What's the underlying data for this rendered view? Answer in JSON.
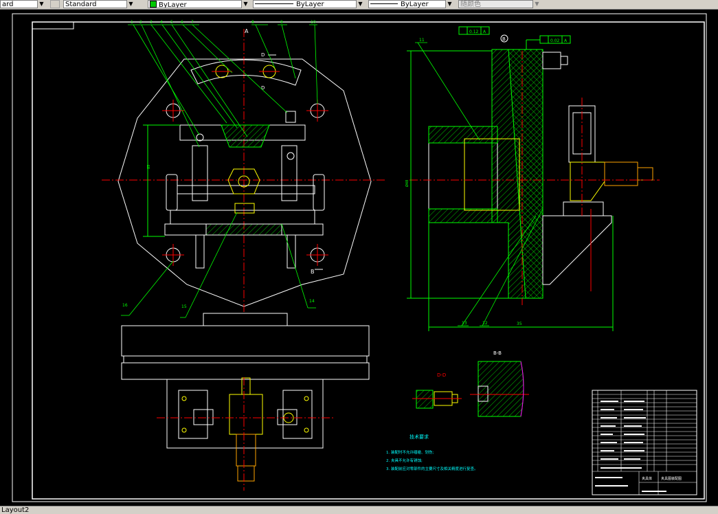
{
  "toolbar": {
    "textstyle_value": "ard",
    "dimstyle_value": "Standard",
    "layer_value": "ByLayer",
    "linetype_value": "ByLayer",
    "lineweight_value": "ByLayer",
    "plotstyle_value": "随颜色"
  },
  "status": {
    "layout_tab": "Layout2"
  },
  "drawing": {
    "section_bb": "B-B",
    "section_dd": "D-D",
    "section_a": "A",
    "label_b": "B",
    "label_d": "D",
    "tolerance_1": "0.12",
    "tolerance_1_datum": "A",
    "tolerance_2": "0.02",
    "tolerance_2_datum": "A",
    "datum_b": "B",
    "tech_title": "技术要求",
    "tech_notes": [
      "1. 装配时不允许磕碰、划伤;",
      "2. 夹具不允许有锈蚀;",
      "3. 装配前应对零部件的主要尺寸及相关精度进行复查。"
    ],
    "callouts": [
      "1",
      "2",
      "3",
      "4",
      "5",
      "6",
      "7",
      "8",
      "9",
      "10",
      "11",
      "12",
      "13",
      "14",
      "15",
      "16"
    ],
    "dim_height": "85",
    "dim_width": "35",
    "dim_left": "Ø48",
    "title_block_name": "夹具体",
    "title_block_part": "夹具图装配图"
  },
  "colors": {
    "outline": "#ffffff",
    "leader": "#00ff00",
    "center": "#ff0000",
    "part": "#ffff00",
    "hatch": "#00ff00",
    "accent_part": "#ffa500",
    "text_cyan": "#00ffff",
    "text_red": "#ff0000",
    "magenta": "#ff00ff"
  }
}
